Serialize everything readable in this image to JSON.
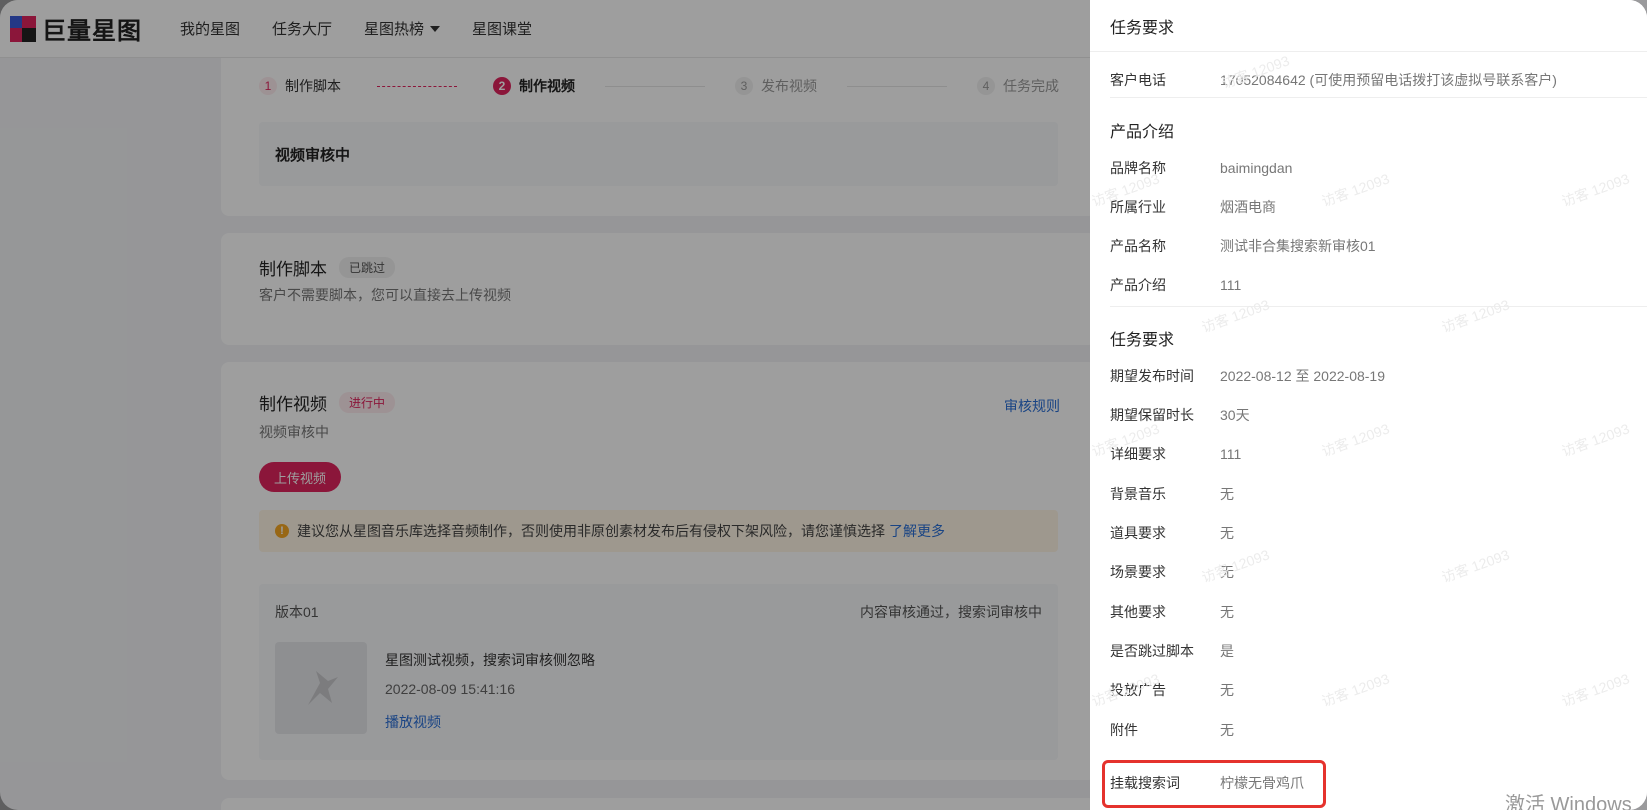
{
  "header": {
    "logo_text": "巨量星图",
    "nav": [
      "我的星图",
      "任务大厅",
      "星图热榜",
      "星图课堂"
    ]
  },
  "steps": [
    {
      "num": "1",
      "label": "制作脚本"
    },
    {
      "num": "2",
      "label": "制作视频"
    },
    {
      "num": "3",
      "label": "发布视频"
    },
    {
      "num": "4",
      "label": "任务完成"
    }
  ],
  "review_box": "视频审核中",
  "script_section": {
    "title": "制作脚本",
    "tag": "已跳过",
    "subtitle": "客户不需要脚本，您可以直接去上传视频"
  },
  "video_section": {
    "title": "制作视频",
    "tag": "进行中",
    "subtitle": "视频审核中",
    "rule_link": "审核规则",
    "upload_button": "上传视频",
    "notice_text": "建议您从星图音乐库选择音频制作，否则使用非原创素材发布后有侵权下架风险，请您谨慎选择",
    "notice_link": "了解更多",
    "version": {
      "title": "版本01",
      "status": "内容审核通过，搜索词审核中",
      "video_title": "星图测试视频，搜索词审核侧忽略",
      "video_time": "2022-08-09 15:41:16",
      "play_link": "播放视频"
    }
  },
  "drawer": {
    "title": "任务要求",
    "phone": {
      "label": "客户电话",
      "value": "17052084642 (可使用预留电话拨打该虚拟号联系客户)"
    },
    "product": {
      "title": "产品介绍",
      "rows": [
        {
          "label": "品牌名称",
          "value": "baimingdan"
        },
        {
          "label": "所属行业",
          "value": "烟酒电商"
        },
        {
          "label": "产品名称",
          "value": "测试非合集搜索新审核01"
        },
        {
          "label": "产品介绍",
          "value": "111"
        }
      ]
    },
    "task": {
      "title": "任务要求",
      "rows": [
        {
          "label": "期望发布时间",
          "value": "2022-08-12 至 2022-08-19"
        },
        {
          "label": "期望保留时长",
          "value": "30天"
        },
        {
          "label": "详细要求",
          "value": "111"
        },
        {
          "label": "背景音乐",
          "value": "无"
        },
        {
          "label": "道具要求",
          "value": "无"
        },
        {
          "label": "场景要求",
          "value": "无"
        },
        {
          "label": "其他要求",
          "value": "无"
        },
        {
          "label": "是否跳过脚本",
          "value": "是"
        },
        {
          "label": "投放广告",
          "value": "无"
        },
        {
          "label": "附件",
          "value": "无"
        },
        {
          "label": "挂载搜索词",
          "value": "柠檬无骨鸡爪"
        }
      ]
    },
    "watermark": "访客 12093"
  },
  "os_watermark": "激活 Windows"
}
